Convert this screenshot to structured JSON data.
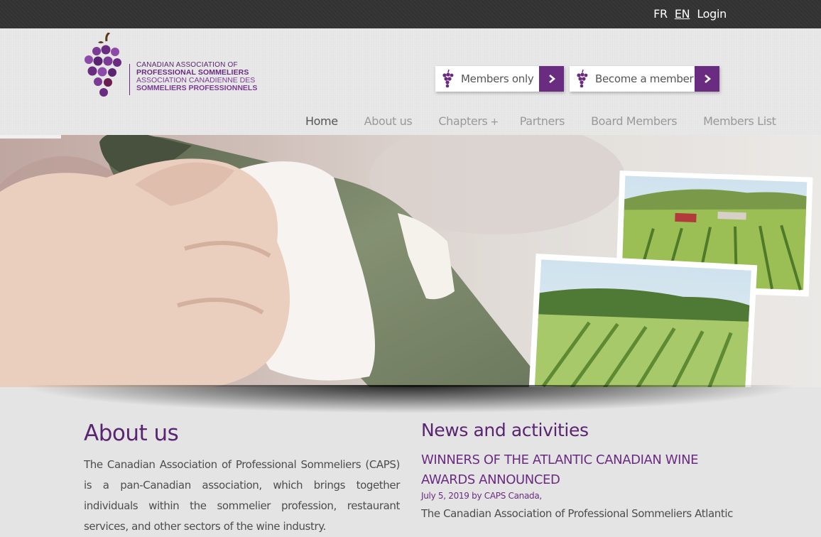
{
  "topbar": {
    "lang_fr": "FR",
    "lang_en": "EN",
    "login": "Login"
  },
  "logo": {
    "line1": "CANADIAN ASSOCIATION OF",
    "line2": "PROFESSIONAL SOMMELIERS",
    "line3": "ASSOCIATION CANADIENNE DES",
    "line4": "SOMMELIERS PROFESSIONNELS",
    "icon": "grape-icon"
  },
  "cta": {
    "members_only": "Members only",
    "become_member": "Become a member"
  },
  "nav": {
    "home": "Home",
    "about": "About us",
    "chapters": "Chapters",
    "chapters_plus": "+",
    "partners": "Partners",
    "board": "Board Members",
    "members_list": "Members List"
  },
  "about": {
    "heading": "About us",
    "text": "The Canadian Association of Professional Sommeliers (CAPS) is a pan-Canadian association, which brings together individuals within the sommelier profession, restaurant services, and other sectors of the wine industry."
  },
  "news": {
    "heading": "News and activities",
    "title": "Winners of the Atlantic Canadian Wine Awards announced",
    "date": "July 5, 2019",
    "by": "by",
    "author": "CAPS Canada,",
    "excerpt": "The Canadian Association of Professional Sommeliers Atlantic"
  },
  "colors": {
    "brand_purple": "#6a2c80",
    "topbar": "#333333",
    "background": "#e4e4e4"
  }
}
